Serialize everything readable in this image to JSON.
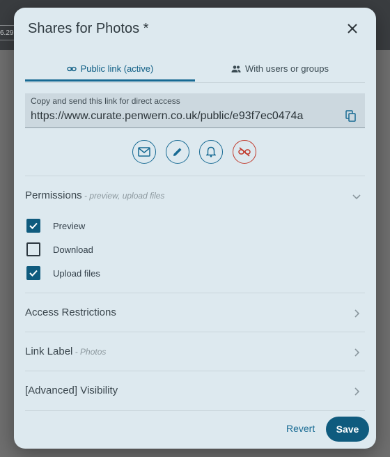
{
  "background": {
    "tag": "6.29"
  },
  "dialog": {
    "title": "Shares for Photos *",
    "tabs": [
      {
        "label": "Public link (active)",
        "icon": "link-icon",
        "active": true
      },
      {
        "label": "With users or groups",
        "icon": "people-icon",
        "active": false
      }
    ],
    "link": {
      "label": "Copy and send this link for direct access",
      "url": "https://www.curate.penwern.co.uk/public/e93f7ec0474a"
    },
    "action_icons": [
      "email-icon",
      "edit-icon",
      "bell-icon",
      "disable-link-icon"
    ],
    "permissions": {
      "title": "Permissions",
      "summary": " - preview, upload files",
      "options": [
        {
          "label": "Preview",
          "checked": true
        },
        {
          "label": "Download",
          "checked": false
        },
        {
          "label": "Upload files",
          "checked": true
        }
      ]
    },
    "access_restrictions": {
      "title": "Access Restrictions"
    },
    "link_label": {
      "title": "Link Label",
      "summary": " - Photos"
    },
    "visibility": {
      "title": "[Advanced] Visibility"
    },
    "buttons": {
      "revert": "Revert",
      "save": "Save"
    },
    "colors": {
      "accent": "#176a93",
      "danger": "#c0392b",
      "panel": "#dde9ef"
    }
  }
}
